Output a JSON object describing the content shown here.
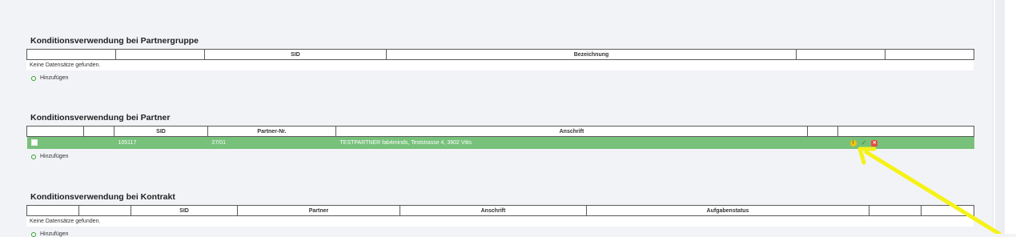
{
  "section_partnergruppe": {
    "title": "Konditionsverwendung bei Partnergruppe",
    "columns": [
      "",
      "",
      "SID",
      "Bezeichnung",
      "",
      ""
    ],
    "empty_text": "Keine Datensätze gefunden.",
    "add_label": "Hinzufügen"
  },
  "section_partner": {
    "title": "Konditionsverwendung bei Partner",
    "columns": [
      "",
      "",
      "SID",
      "Partner-Nr.",
      "Anschrift",
      "",
      ""
    ],
    "rows": [
      {
        "sid": "105117",
        "partner_nr": "27/01",
        "anschrift": "TESTPARTNER fab4minds, Teststrasse 4, 3902 Vitis"
      }
    ],
    "add_label": "Hinzufügen"
  },
  "section_kontrakt": {
    "title": "Konditionsverwendung bei Kontrakt",
    "columns": [
      "",
      "",
      "SID",
      "Partner",
      "Anschrift",
      "Aufgabenstatus",
      "",
      ""
    ],
    "empty_text": "Keine Datensätze gefunden.",
    "add_label": "Hinzufügen"
  },
  "colors": {
    "row_highlight": "#77c17a",
    "annotation_arrow": "#f5f218"
  },
  "icons": [
    "add-circle-icon",
    "warning-icon",
    "check-icon",
    "delete-icon",
    "annotation-arrow"
  ]
}
